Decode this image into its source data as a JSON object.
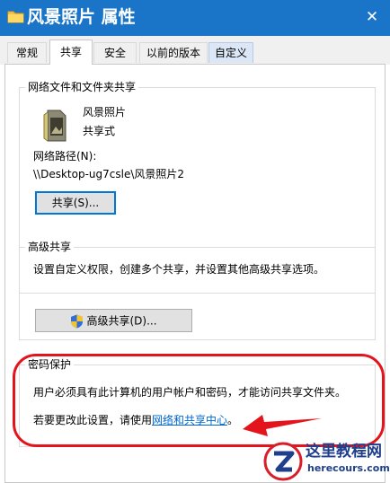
{
  "window": {
    "title": "风景照片 属性",
    "close_glyph": "✕"
  },
  "tabs": [
    {
      "label": "常规"
    },
    {
      "label": "共享"
    },
    {
      "label": "安全"
    },
    {
      "label": "以前的版本"
    },
    {
      "label": "自定义"
    }
  ],
  "network_share": {
    "group_title": "网络文件和文件夹共享",
    "folder_name": "风景照片",
    "share_status": "共享式",
    "path_label": "网络路径(N):",
    "path_value": "\\\\Desktop-ug7csle\\风景照片2",
    "share_button": "共享(S)..."
  },
  "advanced_share": {
    "group_title": "高级共享",
    "description": "设置自定义权限，创建多个共享，并设置其他高级共享选项。",
    "button": "高级共享(D)..."
  },
  "password_protection": {
    "group_title": "密码保护",
    "description": "用户必须具有此计算机的用户帐户和密码，才能访问共享文件夹。",
    "change_prefix": "若要更改此设置，请使用",
    "change_link": "网络和共享中心",
    "change_suffix": "。"
  },
  "watermark": {
    "name": "这里教程网",
    "url": "herecours.com"
  },
  "colors": {
    "titlebar": "#1a74c8",
    "annotation": "#e3141b",
    "link": "#0066cc"
  },
  "icons": {
    "title": "folder-icon",
    "folder": "folder-icon",
    "shield": "uac-shield-icon",
    "close": "close-icon"
  }
}
